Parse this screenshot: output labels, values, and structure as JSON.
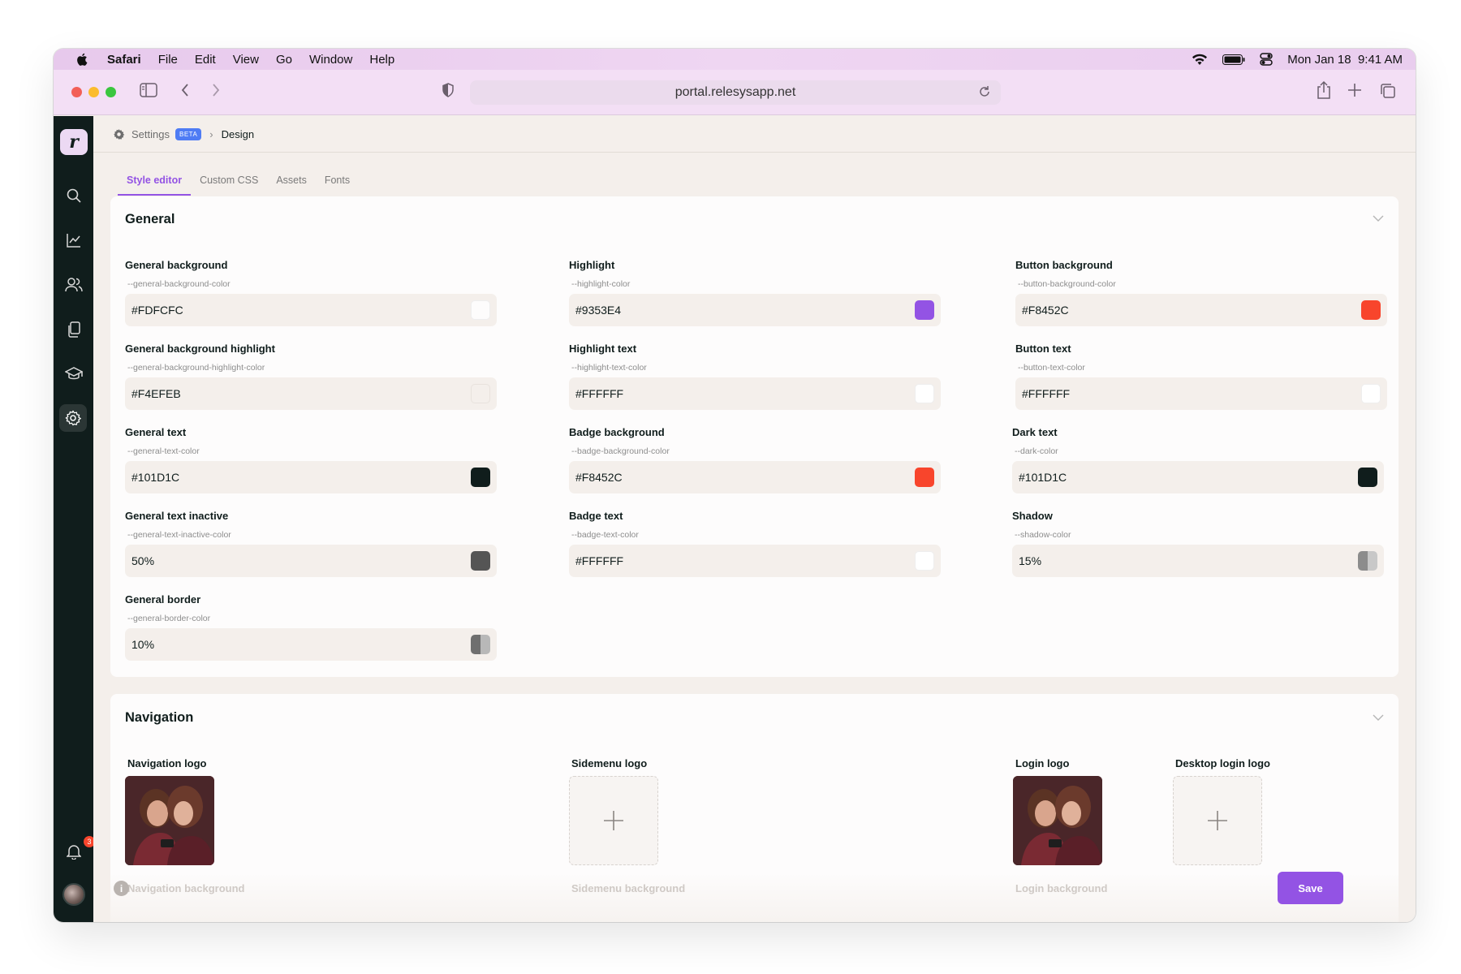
{
  "macos": {
    "app": "Safari",
    "menus": [
      "File",
      "Edit",
      "View",
      "Go",
      "Window",
      "Help"
    ],
    "date": "Mon Jan 18",
    "time": "9:41 AM"
  },
  "browser": {
    "url": "portal.relesysapp.net",
    "traffic_light_colors": [
      "#F25F57",
      "#FBBC2E",
      "#3AC63F"
    ]
  },
  "sidebar": {
    "logo": "r",
    "items": [
      "search-icon",
      "analytics-icon",
      "users-icon",
      "pages-icon",
      "academy-icon",
      "settings-icon"
    ],
    "notification_count": "3"
  },
  "breadcrumb": {
    "settings": "Settings",
    "badge": "BETA",
    "current": "Design"
  },
  "tabs": [
    {
      "label": "Style editor",
      "active": true
    },
    {
      "label": "Custom CSS",
      "active": false
    },
    {
      "label": "Assets",
      "active": false
    },
    {
      "label": "Fonts",
      "active": false
    }
  ],
  "general": {
    "title": "General",
    "fields": [
      {
        "label": "General background",
        "var": "--general-background-color",
        "value": "#FDFCFC",
        "swatch": "#FDFCFC"
      },
      {
        "label": "General background highlight",
        "var": "--general-background-highlight-color",
        "value": "#F4EFEB",
        "swatch": "#F4EFEB"
      },
      {
        "label": "General text",
        "var": "--general-text-color",
        "value": "#101D1C",
        "swatch": "#101D1C"
      },
      {
        "label": "General text inactive",
        "var": "--general-text-inactive-color",
        "value": "50%",
        "swatch": "#555555"
      },
      {
        "label": "General border",
        "var": "--general-border-color",
        "value": "10%",
        "swatch": "split"
      },
      {
        "label": "Highlight",
        "var": "--highlight-color",
        "value": "#9353E4",
        "swatch": "#9353E4"
      },
      {
        "label": "Highlight text",
        "var": "--highlight-text-color",
        "value": "#FFFFFF",
        "swatch": "#FFFFFF"
      },
      {
        "label": "Badge background",
        "var": "--badge-background-color",
        "value": "#F8452C",
        "swatch": "#F8452C"
      },
      {
        "label": "Badge text",
        "var": "--badge-text-color",
        "value": "#FFFFFF",
        "swatch": "#FFFFFF"
      },
      {
        "label": "Button background",
        "var": "--button-background-color",
        "value": "#F8452C",
        "swatch": "#F8452C"
      },
      {
        "label": "Button text",
        "var": "--button-text-color",
        "value": "#FFFFFF",
        "swatch": "#FFFFFF"
      },
      {
        "label": "Dark text",
        "var": "--dark-color",
        "value": "#101D1C",
        "swatch": "#101D1C"
      },
      {
        "label": "Shadow",
        "var": "--shadow-color",
        "value": "15%",
        "swatch": "split2"
      }
    ]
  },
  "navigation": {
    "title": "Navigation",
    "logos": [
      {
        "label": "Navigation logo",
        "has_image": true
      },
      {
        "label": "Sidemenu logo",
        "has_image": false
      },
      {
        "label": "Login logo",
        "has_image": true
      },
      {
        "label": "Desktop login logo",
        "has_image": false
      }
    ],
    "backgrounds": [
      "Navigation background",
      "Sidemenu background",
      "Login background"
    ]
  },
  "actions": {
    "save": "Save",
    "info": "i"
  }
}
